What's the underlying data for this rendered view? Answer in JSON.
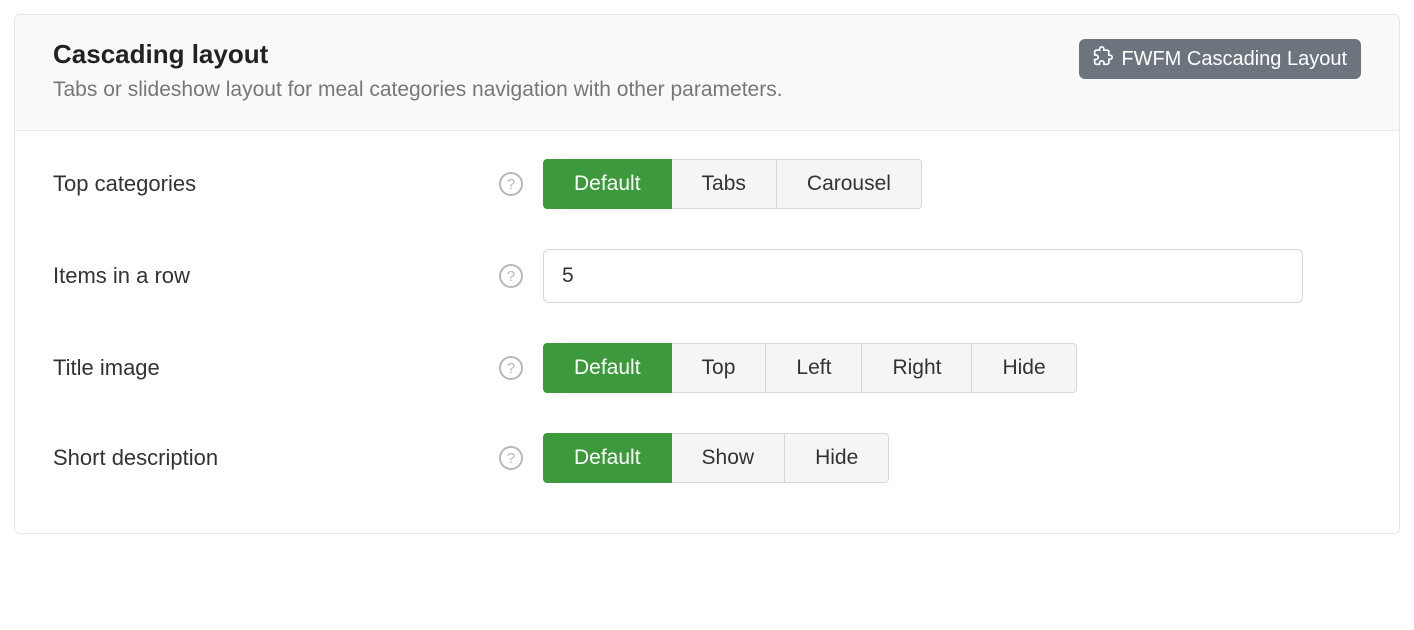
{
  "header": {
    "title": "Cascading layout",
    "description": "Tabs or slideshow layout for meal categories navigation with other parameters.",
    "badge_label": "FWFM Cascading Layout"
  },
  "rows": {
    "top_categories": {
      "label": "Top categories",
      "options": [
        "Default",
        "Tabs",
        "Carousel"
      ],
      "selected": "Default"
    },
    "items_in_row": {
      "label": "Items in a row",
      "value": "5"
    },
    "title_image": {
      "label": "Title image",
      "options": [
        "Default",
        "Top",
        "Left",
        "Right",
        "Hide"
      ],
      "selected": "Default"
    },
    "short_description": {
      "label": "Short description",
      "options": [
        "Default",
        "Show",
        "Hide"
      ],
      "selected": "Default"
    }
  }
}
